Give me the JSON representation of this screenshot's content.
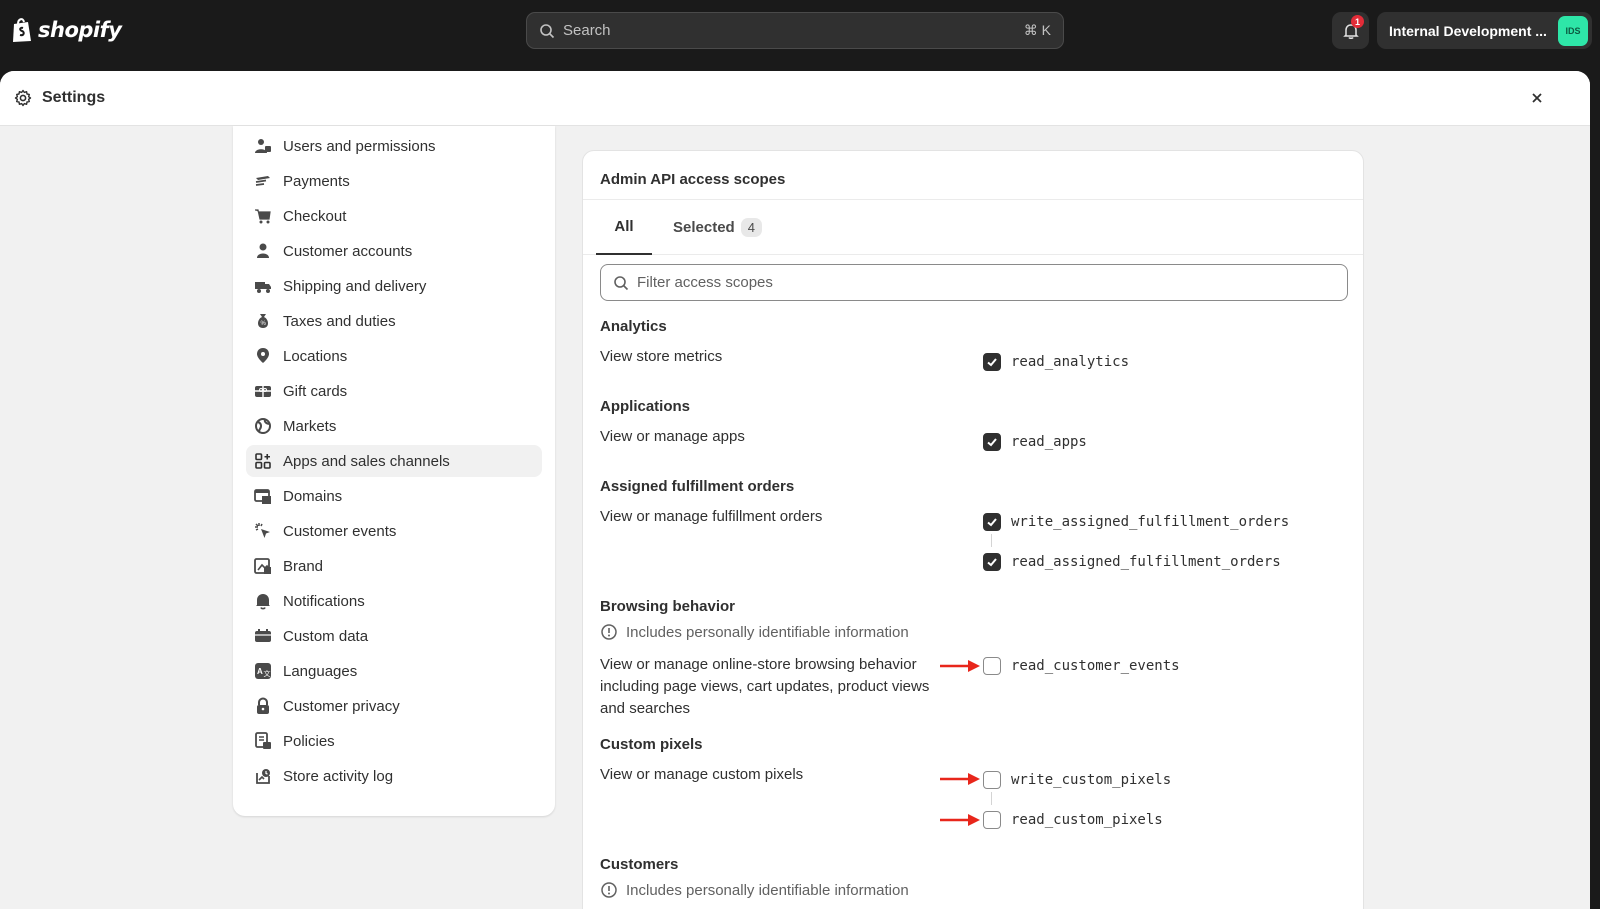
{
  "topbar": {
    "brand": "shopify",
    "search_label": "Search",
    "search_shortcut": "⌘ K",
    "notification_count": "1",
    "store_name": "Internal Development ...",
    "store_initials": "IDS"
  },
  "settings": {
    "title": "Settings"
  },
  "nav": {
    "items": [
      {
        "label": "Users and permissions",
        "icon": "users-icon"
      },
      {
        "label": "Payments",
        "icon": "payments-icon"
      },
      {
        "label": "Checkout",
        "icon": "cart-icon"
      },
      {
        "label": "Customer accounts",
        "icon": "person-icon"
      },
      {
        "label": "Shipping and delivery",
        "icon": "truck-icon"
      },
      {
        "label": "Taxes and duties",
        "icon": "tax-icon"
      },
      {
        "label": "Locations",
        "icon": "location-icon"
      },
      {
        "label": "Gift cards",
        "icon": "gift-card-icon"
      },
      {
        "label": "Markets",
        "icon": "globe-icon"
      },
      {
        "label": "Apps and sales channels",
        "icon": "apps-icon",
        "active": true
      },
      {
        "label": "Domains",
        "icon": "domains-icon"
      },
      {
        "label": "Customer events",
        "icon": "cursor-icon"
      },
      {
        "label": "Brand",
        "icon": "brand-icon"
      },
      {
        "label": "Notifications",
        "icon": "bell-icon"
      },
      {
        "label": "Custom data",
        "icon": "custom-data-icon"
      },
      {
        "label": "Languages",
        "icon": "language-icon"
      },
      {
        "label": "Customer privacy",
        "icon": "lock-icon"
      },
      {
        "label": "Policies",
        "icon": "policies-icon"
      },
      {
        "label": "Store activity log",
        "icon": "activity-log-icon"
      }
    ]
  },
  "scopes": {
    "title": "Admin API access scopes",
    "tab_all": "All",
    "tab_selected": "Selected",
    "selected_count": "4",
    "filter_placeholder": "Filter access scopes",
    "pii_note": "Includes personally identifiable information",
    "sections": [
      {
        "title": "Analytics",
        "description": "View store metrics",
        "scopes": [
          {
            "name": "read_analytics",
            "checked": true
          }
        ]
      },
      {
        "title": "Applications",
        "description": "View or manage apps",
        "scopes": [
          {
            "name": "read_apps",
            "checked": true
          }
        ]
      },
      {
        "title": "Assigned fulfillment orders",
        "description": "View or manage fulfillment orders",
        "scopes": [
          {
            "name": "write_assigned_fulfillment_orders",
            "checked": true
          },
          {
            "name": "read_assigned_fulfillment_orders",
            "checked": true
          }
        ]
      },
      {
        "title": "Browsing behavior",
        "pii": true,
        "description": "View or manage online-store browsing behavior including page views, cart updates, product views and searches",
        "scopes": [
          {
            "name": "read_customer_events",
            "checked": false
          }
        ]
      },
      {
        "title": "Custom pixels",
        "description": "View or manage custom pixels",
        "scopes": [
          {
            "name": "write_custom_pixels",
            "checked": false
          },
          {
            "name": "read_custom_pixels",
            "checked": false
          }
        ]
      },
      {
        "title": "Customers",
        "pii": true
      }
    ]
  },
  "colors": {
    "annotation_arrow": "#e8261b",
    "avatar_bg": "#2ee6a8",
    "topbar_bg": "#1a1a1a"
  }
}
